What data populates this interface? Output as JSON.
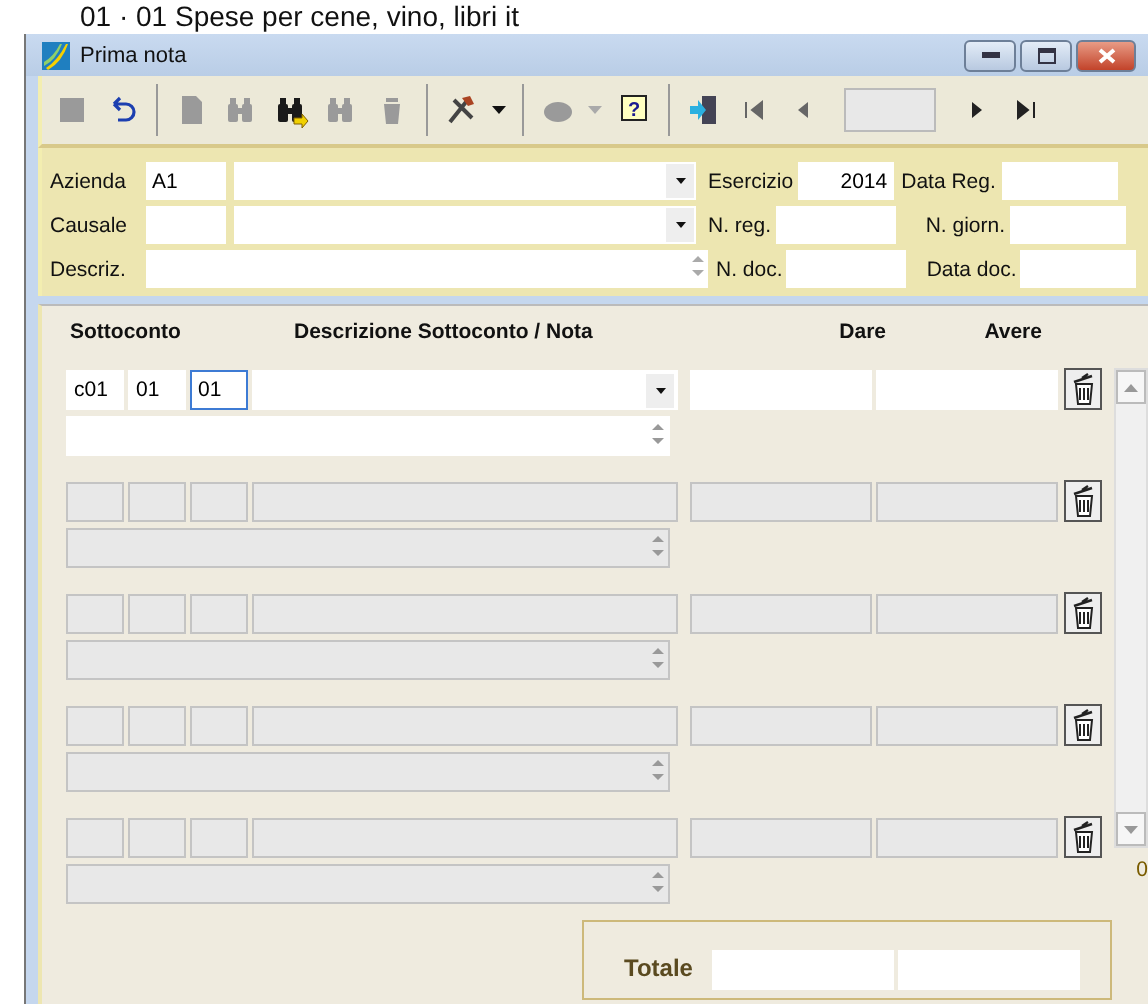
{
  "caption": "01 · 01 Spese per cene, vino, libri it",
  "window": {
    "title": "Prima nota"
  },
  "toolbar": [
    {
      "kind": "save",
      "disabled": true
    },
    {
      "kind": "undo",
      "disabled": false
    },
    {
      "kind": "sep"
    },
    {
      "kind": "new",
      "disabled": true
    },
    {
      "kind": "find",
      "disabled": true
    },
    {
      "kind": "findnext",
      "disabled": false
    },
    {
      "kind": "findlist",
      "disabled": true
    },
    {
      "kind": "delete",
      "disabled": true
    },
    {
      "kind": "sep"
    },
    {
      "kind": "tools",
      "disabled": false
    },
    {
      "kind": "sep"
    },
    {
      "kind": "print",
      "disabled": true
    },
    {
      "kind": "help",
      "disabled": false,
      "glyph": "?"
    },
    {
      "kind": "sep"
    },
    {
      "kind": "exit",
      "disabled": false
    },
    {
      "kind": "first",
      "disabled": true
    },
    {
      "kind": "prev",
      "disabled": true
    },
    {
      "kind": "page"
    },
    {
      "kind": "next",
      "disabled": false
    },
    {
      "kind": "last",
      "disabled": false
    }
  ],
  "header": {
    "azienda": {
      "label": "Azienda",
      "code": "A1"
    },
    "causale": {
      "label": "Causale"
    },
    "descriz": {
      "label": "Descriz."
    },
    "esercizio": {
      "label": "Esercizio",
      "value": "2014"
    },
    "data_reg": {
      "label": "Data Reg."
    },
    "n_reg": {
      "label": "N. reg."
    },
    "n_giorn": {
      "label": "N. giorn."
    },
    "n_doc": {
      "label": "N. doc."
    },
    "data_doc": {
      "label": "Data doc."
    }
  },
  "columns": [
    "Sottoconto",
    "Descrizione Sottoconto / Nota",
    "Dare",
    "Avere"
  ],
  "rows": [
    {
      "enabled": true,
      "codes": [
        "c01",
        "01",
        "01"
      ]
    },
    {
      "enabled": false,
      "codes": []
    },
    {
      "enabled": false,
      "codes": []
    },
    {
      "enabled": false,
      "codes": []
    },
    {
      "enabled": false,
      "codes": []
    }
  ],
  "row_count": "0",
  "totals": {
    "label": "Totale"
  }
}
